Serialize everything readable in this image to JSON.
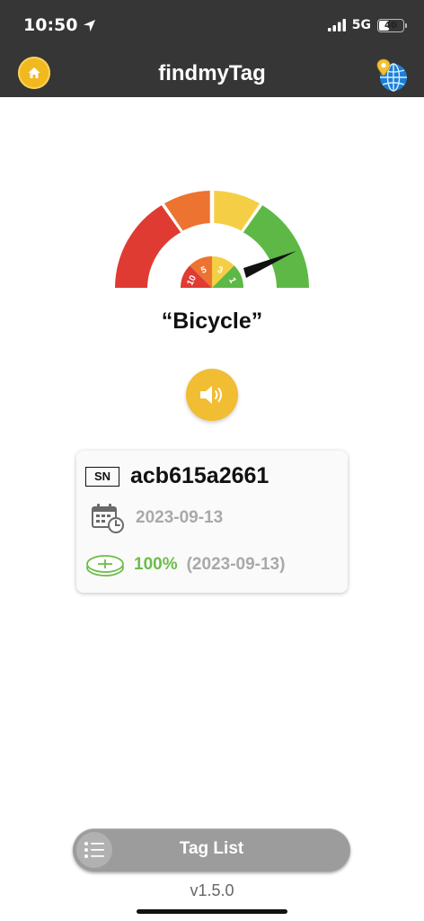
{
  "status_bar": {
    "time": "10:50",
    "network": "5G",
    "battery": "40"
  },
  "header": {
    "title": "findmyTag"
  },
  "gauge": {
    "inner_labels": [
      "10",
      "5",
      "3",
      "1"
    ]
  },
  "tag": {
    "name": "“Bicycle”"
  },
  "card": {
    "sn_label": "SN",
    "sn_value": "acb615a2661",
    "date": "2023-09-13",
    "battery_percent": "100%",
    "battery_date": "(2023-09-13)"
  },
  "footer": {
    "tag_list_label": "Tag List",
    "version": "v1.5.0"
  },
  "colors": {
    "header_bg": "#363636",
    "accent_yellow": "#f1bd33",
    "gauge_red": "#df3b32",
    "gauge_orange": "#ec7330",
    "gauge_yellow": "#f4cf45",
    "gauge_green": "#5db845",
    "battery_green": "#6cbd4a"
  }
}
